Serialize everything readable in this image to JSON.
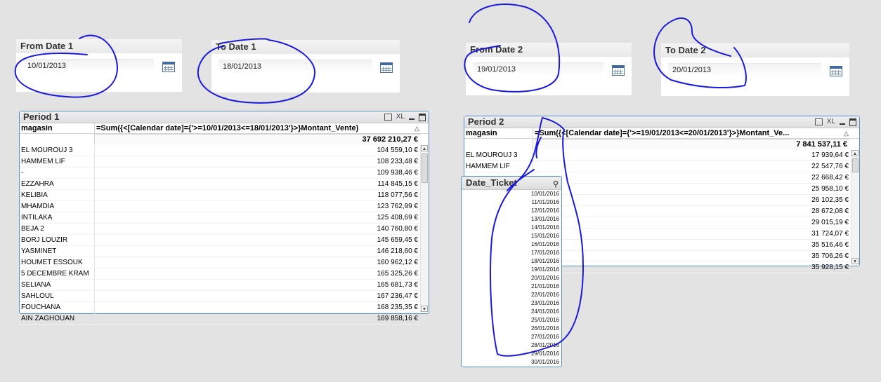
{
  "inputs": {
    "from1": {
      "title": "From Date 1",
      "value": "10/01/2013"
    },
    "to1": {
      "title": "To Date 1",
      "value": "18/01/2013"
    },
    "from2": {
      "title": "From Date 2",
      "value": "19/01/2013"
    },
    "to2": {
      "title": "To Date 2",
      "value": "20/01/2013"
    }
  },
  "table1": {
    "title": "Period 1",
    "col1": "magasin",
    "col2": "=Sum({<[Calendar date]={'>=10/01/2013<=18/01/2013'}>}Montant_Vente)",
    "total": "37 692 210,27 €",
    "rows": [
      {
        "name": "EL MOUROUJ 3",
        "value": "104 559,10 €"
      },
      {
        "name": "HAMMEM LIF",
        "value": "108 233,48 €"
      },
      {
        "name": "-",
        "value": "109 938,46 €"
      },
      {
        "name": "EZZAHRA",
        "value": "114 845,15 €"
      },
      {
        "name": "KELIBIA",
        "value": "118 077,56 €"
      },
      {
        "name": "MHAMDIA",
        "value": "123 762,99 €"
      },
      {
        "name": "INTILAKA",
        "value": "125 408,69 €"
      },
      {
        "name": "BEJA 2",
        "value": "140 760,80 €"
      },
      {
        "name": "BORJ LOUZIR",
        "value": "145 659,45 €"
      },
      {
        "name": "YASMINET",
        "value": "146 218,60 €"
      },
      {
        "name": "HOUMET ESSOUK",
        "value": "160 962,12 €"
      },
      {
        "name": "5 DECEMBRE KRAM",
        "value": "165 325,26 €"
      },
      {
        "name": "SELIANA",
        "value": "165 681,73 €"
      },
      {
        "name": "SAHLOUL",
        "value": "167 236,47 €"
      },
      {
        "name": "FOUCHANA",
        "value": "168 235,35 €"
      },
      {
        "name": "AIN ZAGHOUAN",
        "value": "169 858,16 €"
      }
    ]
  },
  "table2": {
    "title": "Period 2",
    "col1": "magasin",
    "col2": "=Sum({<[Calendar date]={'>=19/01/2013<=20/01/2013'}>}Montant_Ve...",
    "total": "7 841 537,11 €",
    "rows": [
      {
        "name": "EL MOUROUJ 3",
        "value": "17 939,64 €"
      },
      {
        "name": "HAMMEM LIF",
        "value": "22 547,76 €"
      },
      {
        "name": "",
        "value": "22 668,42 €"
      },
      {
        "name": "",
        "value": "25 958,10 €"
      },
      {
        "name": "",
        "value": "26 102,35 €"
      },
      {
        "name": "",
        "value": "28 672,08 €"
      },
      {
        "name": "",
        "value": "29 015,19 €"
      },
      {
        "name": "",
        "value": "31 724,07 €"
      },
      {
        "name": "",
        "value": "35 516,46 €"
      },
      {
        "name": "",
        "value": "35 706,26 €"
      },
      {
        "name": "",
        "value": "35 928,15 €"
      }
    ]
  },
  "listbox": {
    "title": "Date_Ticket",
    "items": [
      "10/01/2016",
      "11/01/2016",
      "12/01/2016",
      "13/01/2016",
      "14/01/2016",
      "15/01/2016",
      "16/01/2016",
      "17/01/2016",
      "18/01/2016",
      "19/01/2016",
      "20/01/2016",
      "21/01/2016",
      "22/01/2016",
      "23/01/2016",
      "24/01/2016",
      "25/01/2016",
      "26/01/2016",
      "27/01/2016",
      "28/01/2016",
      "29/01/2016",
      "30/01/2016"
    ]
  },
  "controls": {
    "xl_label": "XL"
  },
  "icons": {
    "calendar": "calendar-icon",
    "search": "search-icon",
    "print": "print-icon",
    "minimize": "minimize-icon",
    "maximize": "maximize-icon"
  },
  "colors": {
    "frame_border": "#5a8ec4",
    "annotation_ink": "#1a1adc",
    "background": "#e3e3e3"
  }
}
